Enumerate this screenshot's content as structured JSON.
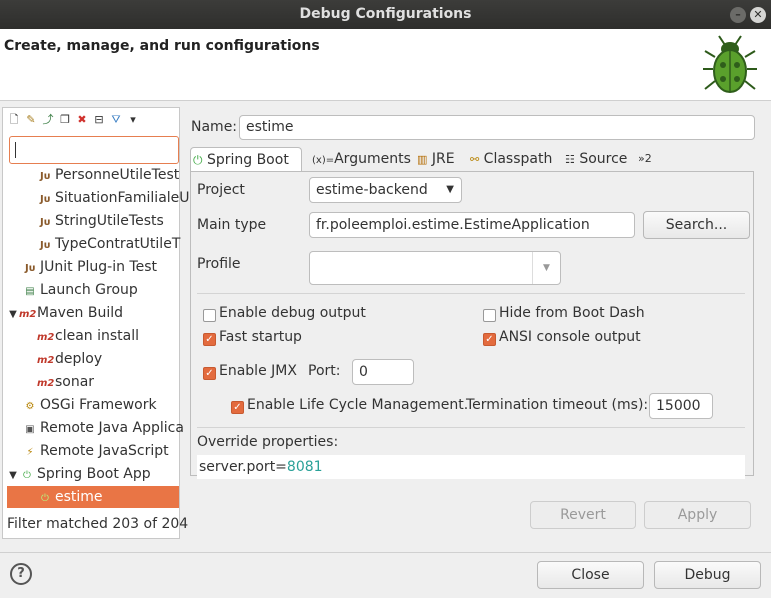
{
  "window": {
    "title": "Debug Configurations"
  },
  "header": {
    "title": "Create, manage, and run configurations"
  },
  "toolbar": {
    "icons": [
      "new-config-icon",
      "new-prototype-icon",
      "export-icon",
      "duplicate-icon",
      "delete-icon",
      "collapse-all-icon",
      "filter-icon",
      "view-menu-icon"
    ]
  },
  "filter": {
    "value": ""
  },
  "tree": {
    "items": [
      {
        "label": "PersonneUtileTest",
        "icon": "junit-icon"
      },
      {
        "label": "SituationFamilialeU",
        "icon": "junit-icon"
      },
      {
        "label": "StringUtileTests",
        "icon": "junit-icon"
      },
      {
        "label": "TypeContratUtileT",
        "icon": "junit-icon"
      },
      {
        "label": "JUnit Plug-in Test",
        "icon": "junit-plugin-icon"
      },
      {
        "label": "Launch Group",
        "icon": "launch-group-icon"
      },
      {
        "label": "Maven Build",
        "icon": "maven-icon"
      },
      {
        "label": "clean install",
        "icon": "maven-icon"
      },
      {
        "label": "deploy",
        "icon": "maven-icon"
      },
      {
        "label": "sonar",
        "icon": "maven-icon"
      },
      {
        "label": "OSGi Framework",
        "icon": "osgi-icon"
      },
      {
        "label": "Remote Java Applica",
        "icon": "remote-java-icon"
      },
      {
        "label": "Remote JavaScript",
        "icon": "remote-js-icon"
      },
      {
        "label": "Spring Boot App",
        "icon": "spring-boot-icon"
      },
      {
        "label": "estime",
        "icon": "spring-boot-icon"
      }
    ],
    "status": "Filter matched 203 of 204"
  },
  "form": {
    "name_label": "Name:",
    "name_value": "estime",
    "tabs": [
      "Spring Boot",
      "Arguments",
      "JRE",
      "Classpath",
      "Source",
      "»2"
    ],
    "project_label": "Project",
    "project_value": "estime-backend",
    "main_type_label": "Main type",
    "main_type_value": "fr.poleemploi.estime.EstimeApplication",
    "search_label": "Search...",
    "profile_label": "Profile",
    "profile_value": "",
    "enable_debug": "Enable debug output",
    "hide_boot_dash": "Hide from Boot Dash",
    "fast_startup": "Fast startup",
    "ansi_console": "ANSI console output",
    "enable_jmx": "Enable JMX",
    "port_label": "Port:",
    "port_value": "0",
    "enable_lifecycle": "Enable Life Cycle Management.",
    "termination_label": "Termination timeout (ms):",
    "termination_value": "15000",
    "override_label": "Override properties:",
    "override_key": "server.port=",
    "override_value": "8081",
    "revert_label": "Revert",
    "apply_label": "Apply"
  },
  "footer": {
    "close_label": "Close",
    "debug_label": "Debug"
  },
  "colors": {
    "accent": "#e97545",
    "override_value": "#2aa198"
  }
}
